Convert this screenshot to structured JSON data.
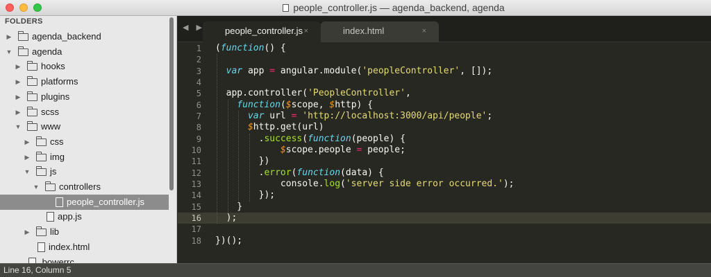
{
  "window": {
    "title": "people_controller.js — agenda_backend, agenda"
  },
  "sidebar": {
    "header": "FOLDERS",
    "items": [
      {
        "label": "agenda_backend",
        "type": "folder",
        "state": "collapsed",
        "depth": 0
      },
      {
        "label": "agenda",
        "type": "folder",
        "state": "expanded",
        "depth": 0
      },
      {
        "label": "hooks",
        "type": "folder",
        "state": "collapsed",
        "depth": 1
      },
      {
        "label": "platforms",
        "type": "folder",
        "state": "collapsed",
        "depth": 1
      },
      {
        "label": "plugins",
        "type": "folder",
        "state": "collapsed",
        "depth": 1
      },
      {
        "label": "scss",
        "type": "folder",
        "state": "collapsed",
        "depth": 1
      },
      {
        "label": "www",
        "type": "folder",
        "state": "expanded",
        "depth": 1
      },
      {
        "label": "css",
        "type": "folder",
        "state": "collapsed",
        "depth": 2
      },
      {
        "label": "img",
        "type": "folder",
        "state": "collapsed",
        "depth": 2
      },
      {
        "label": "js",
        "type": "folder",
        "state": "expanded",
        "depth": 2
      },
      {
        "label": "controllers",
        "type": "folder",
        "state": "expanded",
        "depth": 3
      },
      {
        "label": "people_controller.js",
        "type": "file",
        "state": "selected",
        "depth": 4
      },
      {
        "label": "app.js",
        "type": "file",
        "state": "",
        "depth": 3
      },
      {
        "label": "lib",
        "type": "folder",
        "state": "collapsed",
        "depth": 2
      },
      {
        "label": "index.html",
        "type": "file",
        "state": "",
        "depth": 2
      },
      {
        "label": ".bowerrc",
        "type": "file",
        "state": "",
        "depth": 1
      }
    ]
  },
  "tabs": {
    "nav_arrows": "◀ ▶",
    "items": [
      {
        "label": "people_controller.js",
        "close": "×",
        "active": true
      },
      {
        "label": "index.html",
        "close": "×",
        "active": false
      }
    ]
  },
  "editor": {
    "current_line": 16,
    "line_numbers": [
      "1",
      "2",
      "3",
      "4",
      "5",
      "6",
      "7",
      "8",
      "9",
      "10",
      "11",
      "12",
      "13",
      "14",
      "15",
      "16",
      "17",
      "18"
    ],
    "lines": [
      "(function() {",
      "",
      "  var app = angular.module('peopleController', []);",
      "",
      "  app.controller('PeopleController',",
      "    function($scope, $http) {",
      "      var url = 'http://localhost:3000/api/people';",
      "      $http.get(url)",
      "        .success(function(people) {",
      "            $scope.people = people;",
      "        })",
      "        .error(function(data) {",
      "            console.log('server side error occurred.');",
      "        });",
      "    }",
      "  );",
      "",
      "})();"
    ]
  },
  "status": {
    "position": "Line 16, Column 5"
  },
  "colors": {
    "background": "#272822",
    "keyword": "#66d9ef",
    "operator": "#f92672",
    "string": "#e6db74",
    "parameter": "#fd971f",
    "function": "#a6e22e",
    "text": "#f8f8f2",
    "sidebar_selected": "#8c8c8c"
  }
}
